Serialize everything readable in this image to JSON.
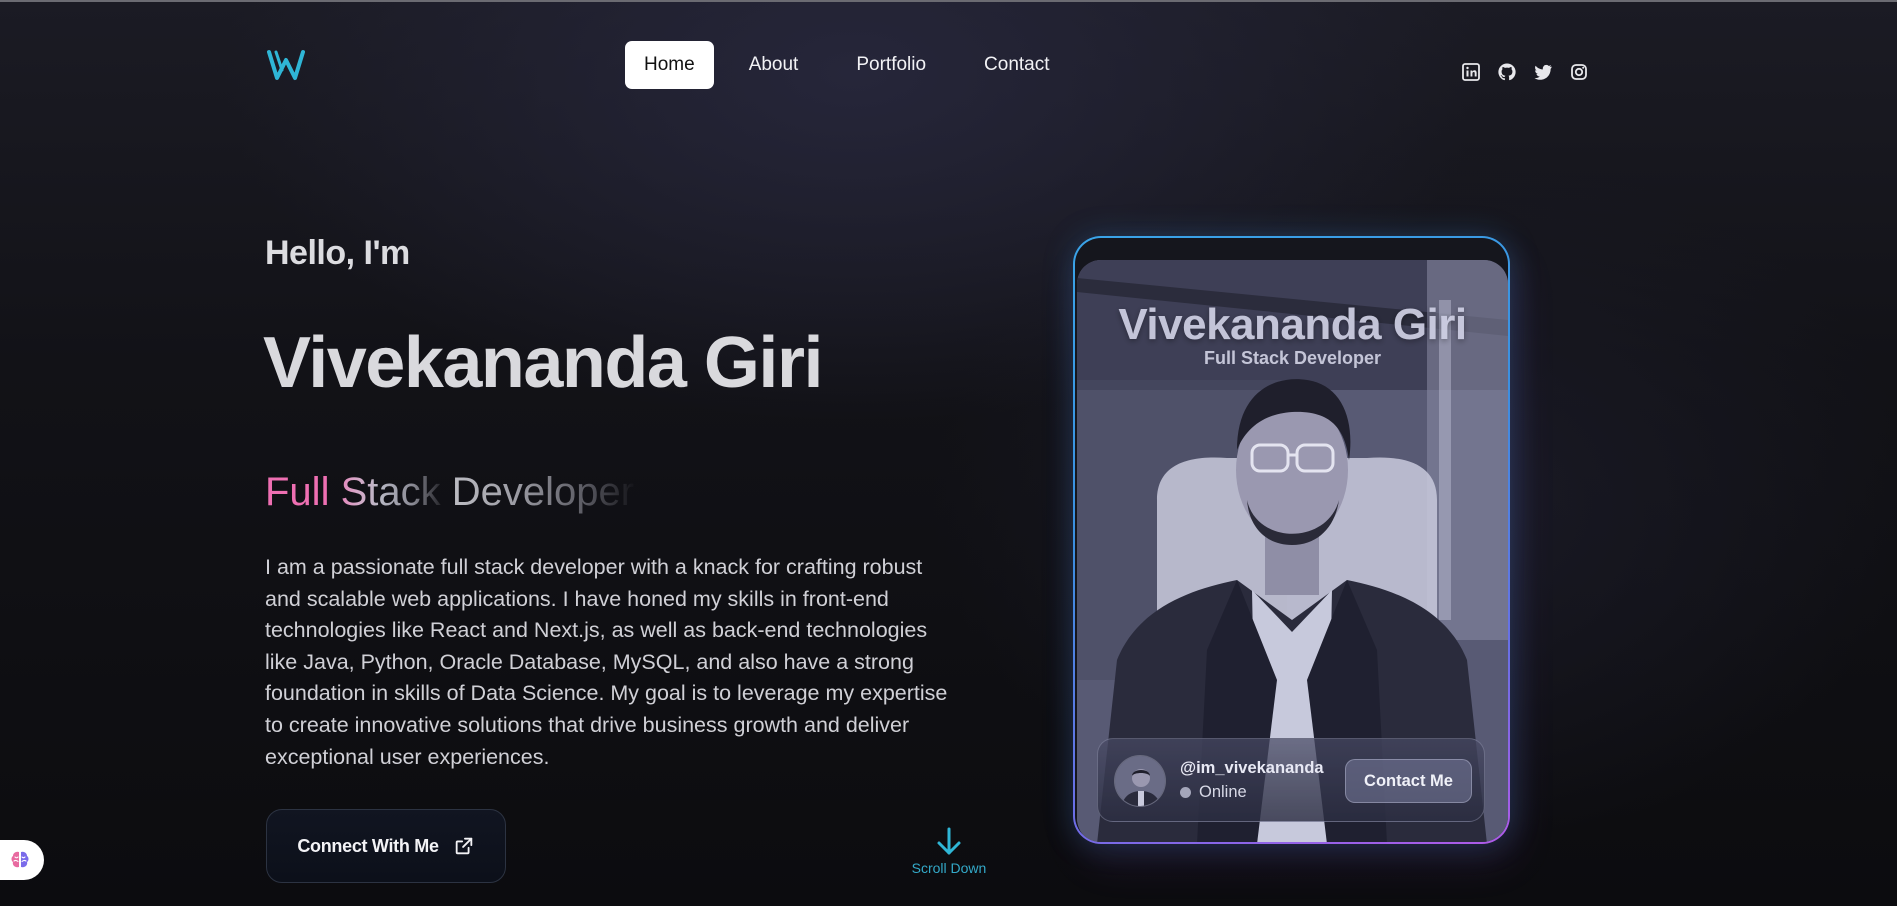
{
  "header": {
    "logo_icon": "w-logo-icon",
    "nav": [
      {
        "label": "Home",
        "active": true
      },
      {
        "label": "About",
        "active": false
      },
      {
        "label": "Portfolio",
        "active": false
      },
      {
        "label": "Contact",
        "active": false
      }
    ],
    "socials": [
      "linkedin-icon",
      "github-icon",
      "twitter-icon",
      "instagram-icon"
    ]
  },
  "hero": {
    "greeting": "Hello, I'm",
    "name": "Vivekananda Giri",
    "role_parts": [
      "Full",
      " Stack",
      " Developer"
    ],
    "bio": "I am a passionate full stack developer with a knack for crafting robust and scalable web applications. I have honed my skills in front-end technologies like React and Next.js, as well as back-end technologies like Java, Python, Oracle Database, MySQL, and also have a strong foundation in skills of Data Science. My goal is to leverage my expertise to create innovative solutions that drive business growth and deliver exceptional user experiences.",
    "connect_label": "Connect With Me",
    "scroll_label": "Scroll Down"
  },
  "card": {
    "title": "Vivekananda Giri",
    "subtitle": "Full Stack Developer",
    "handle": "@im_vivekananda",
    "status": "Online",
    "contact_label": "Contact Me"
  },
  "colors": {
    "accent_cyan": "#2fb6d6",
    "role_pink": "#ee6fb2",
    "card_border_start": "#3aa4e8",
    "card_border_end": "#b05ae8"
  }
}
